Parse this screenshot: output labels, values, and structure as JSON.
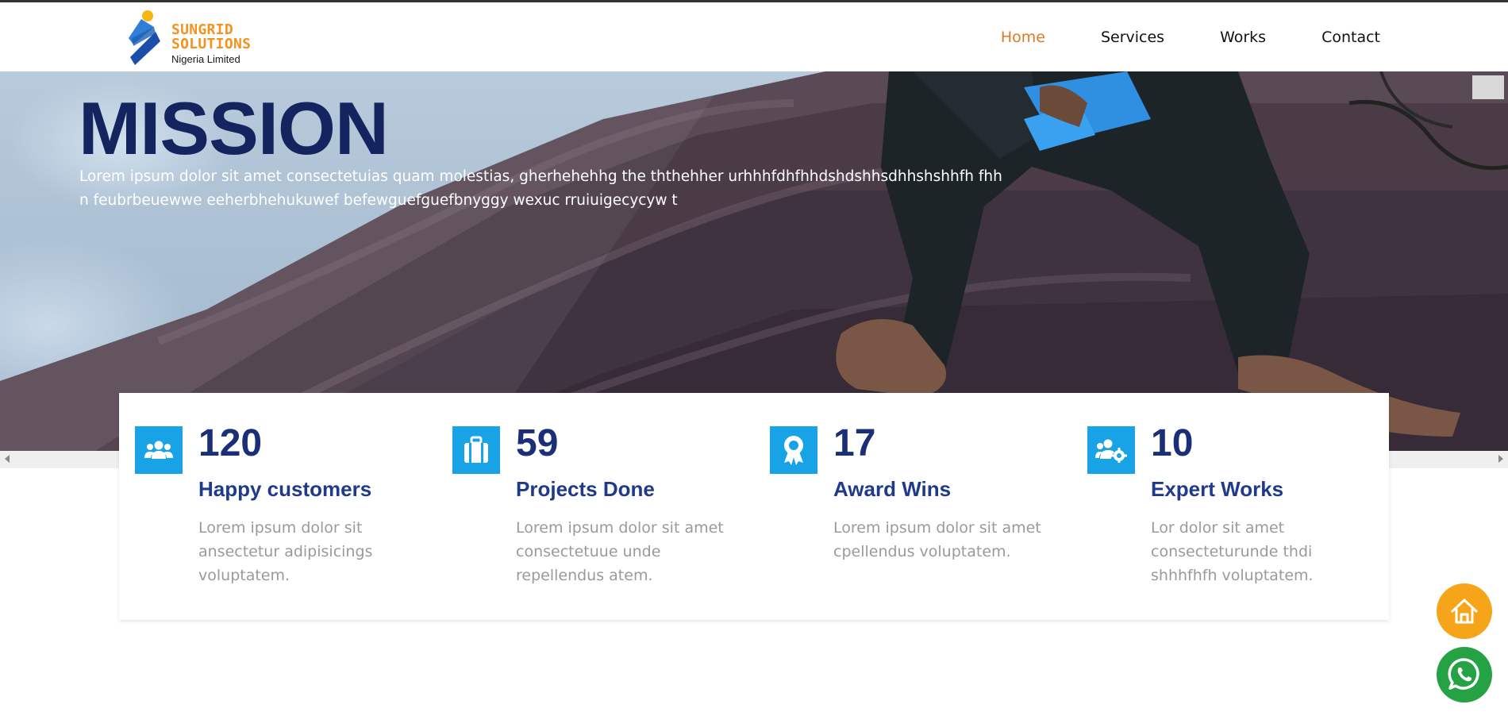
{
  "brand": {
    "line1": "SUNGRID",
    "line2": "SOLUTIONS",
    "line3": "Nigeria Limited",
    "colors": {
      "orange": "#f5921e",
      "blue": "#1f5fbf",
      "sun": "#f6b60d"
    }
  },
  "nav": {
    "items": [
      {
        "label": "Home",
        "active": true
      },
      {
        "label": "Services",
        "active": false
      },
      {
        "label": "Works",
        "active": false
      },
      {
        "label": "Contact",
        "active": false
      }
    ],
    "active_color": "#e2791f"
  },
  "hero": {
    "title": "MISSION",
    "text": "Lorem ipsum dolor sit amet consectetuias quam molestias, gherhehehhg the ththehher urhhhfdhfhhdshdshhsdhhshshhfh fhh n feubrbeuewwe eeherbhehukuwef befewguefguefbnyggy wexuc rruiuigecycyw t"
  },
  "stats": [
    {
      "icon": "users-icon",
      "number": "120",
      "title": "Happy customers",
      "description": "Lorem ipsum dolor sit ansectetur adipisicings voluptatem."
    },
    {
      "icon": "briefcase-icon",
      "number": "59",
      "title": "Projects Done",
      "description": "Lorem ipsum dolor sit amet consectetuue unde repellendus atem."
    },
    {
      "icon": "award-icon",
      "number": "17",
      "title": "Award Wins",
      "description": "Lorem ipsum dolor sit amet cpellendus voluptatem."
    },
    {
      "icon": "users-gear-icon",
      "number": "10",
      "title": "Expert Works",
      "description": "Lor dolor sit amet consecteturunde thdi shhhfhfh voluptatem."
    }
  ],
  "floating": {
    "home_icon": "home-icon",
    "whatsapp_icon": "whatsapp-icon",
    "home_color": "#f6a51a",
    "whatsapp_color": "#25a244"
  },
  "theme": {
    "icon_bg": "#17a3e6",
    "number_color": "#1b2e78",
    "title_color": "#1f3a8a"
  }
}
